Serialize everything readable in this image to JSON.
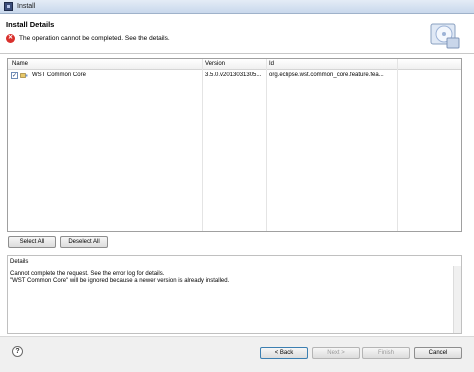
{
  "window": {
    "title": "Install"
  },
  "header": {
    "title": "Install Details",
    "message": "The operation cannot be completed.  See the details."
  },
  "table": {
    "columns": [
      "Name",
      "Version",
      "Id"
    ],
    "rows": [
      {
        "checked": true,
        "name": "WST Common Core",
        "version": "3.5.0.v2013031305...",
        "id": "org.eclipse.wst.common_core.feature.fea..."
      }
    ]
  },
  "buttons": {
    "select_all": "Select All",
    "deselect_all": "Deselect All",
    "back": "< Back",
    "next": "Next >",
    "finish": "Finish",
    "cancel": "Cancel"
  },
  "details": {
    "label": "Details",
    "line1": "Cannot complete the request.  See the error log for details.",
    "line2": "\"WST Common Core\" will be ignored because a newer version is already installed."
  },
  "icons": {
    "app": "install-app-icon",
    "error": "error-icon",
    "banner": "install-banner-icon",
    "help": "help-icon",
    "feature": "plugin-icon"
  }
}
